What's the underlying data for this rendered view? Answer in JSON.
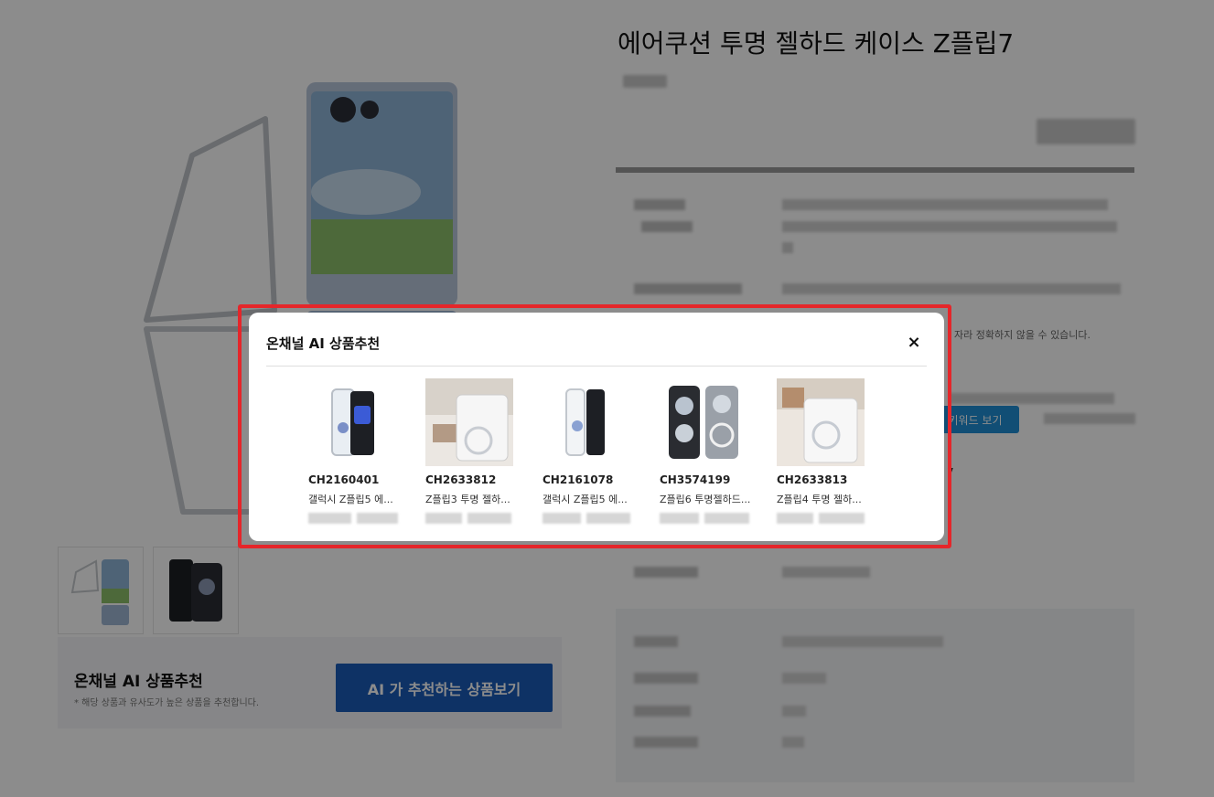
{
  "product": {
    "title": "에어쿠션 투명 젤하드 케이스 Z플립7",
    "keyword_button": "키워드 보기",
    "notice": "자라 정확하지 않을 수 있습니다.",
    "detail_stray_text": "7"
  },
  "ai_banner": {
    "title": "온채널 AI 상품추천",
    "note": "* 해당 상품과 유사도가 높은 상품을 추천합니다.",
    "button": "AI 가 추천하는 상품보기"
  },
  "modal": {
    "title": "온채널 AI 상품추천",
    "close_glyph": "×",
    "items": [
      {
        "code": "CH2160401",
        "name": "갤럭시 Z플립5 에..."
      },
      {
        "code": "CH2633812",
        "name": "Z플립3 투명 젤하..."
      },
      {
        "code": "CH2161078",
        "name": "갤럭시 Z플립5 에..."
      },
      {
        "code": "CH3574199",
        "name": "Z플립6 투명젤하드..."
      },
      {
        "code": "CH2633813",
        "name": "Z플립4 투명 젤하..."
      }
    ]
  },
  "colors": {
    "highlight": "#e5262a",
    "primary_button": "#1a5bb8",
    "keyword_button": "#1f8fd6"
  }
}
